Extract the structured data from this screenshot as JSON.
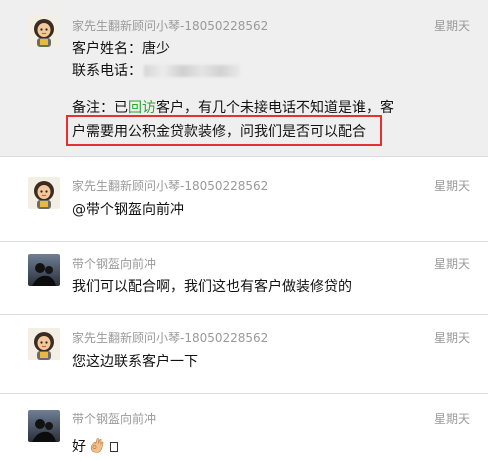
{
  "messages": [
    {
      "sender": "家先生翻新顾问小琴-18050228562",
      "time": "星期天",
      "avatar_icon": "cartoon-girl-avatar-icon",
      "customer_label": "客户姓名：唐少",
      "phone_label": "联系电话：",
      "note_prefix": "备注：已",
      "note_green": "回访",
      "note_rest": "客户，有几个未接电话不知道是谁，客",
      "note_line2": "户需要用公积金贷款装修，问我们是否可以配合",
      "highlight_color": "#e23232",
      "accent_color": "#2aa52a"
    },
    {
      "sender": "家先生翻新顾问小琴-18050228562",
      "time": "星期天",
      "avatar_icon": "cartoon-girl-avatar-icon",
      "text": "@带个钢盔向前冲"
    },
    {
      "sender": "带个钢盔向前冲",
      "time": "星期天",
      "avatar_icon": "silhouette-photo-avatar-icon",
      "text": "我们可以配合啊，我们这也有客户做装修贷的"
    },
    {
      "sender": "家先生翻新顾问小琴-18050228562",
      "time": "星期天",
      "avatar_icon": "cartoon-girl-avatar-icon",
      "text": "您这边联系客户一下"
    },
    {
      "sender": "带个钢盔向前冲",
      "time": "星期天",
      "avatar_icon": "silhouette-photo-avatar-icon",
      "text": "好",
      "emoji_icon": "ok-hand-emoji-icon"
    }
  ]
}
